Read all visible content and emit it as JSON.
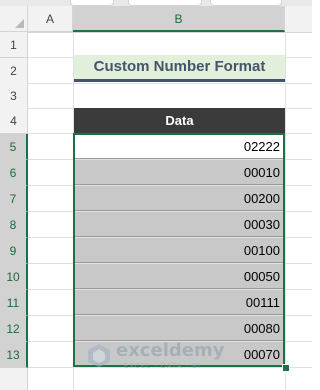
{
  "columns": [
    "A",
    "B"
  ],
  "rows": [
    "1",
    "2",
    "3",
    "4",
    "5",
    "6",
    "7",
    "8",
    "9",
    "10",
    "11",
    "12",
    "13"
  ],
  "title": "Custom Number Format",
  "data_header": "Data",
  "values": [
    "02222",
    "00010",
    "00200",
    "00030",
    "00100",
    "00050",
    "00111",
    "00080",
    "00070"
  ],
  "watermark": {
    "brand": "exceldemy",
    "tagline": "EXCEL · DATA · BI",
    "icon": "exceldemy-logo-icon"
  },
  "colors": {
    "title_fill": "#e2efda",
    "title_text": "#44546a",
    "header_fill": "#3b3b3b",
    "selected_fill": "#c8c8c8",
    "selection_border": "#1e7145"
  }
}
